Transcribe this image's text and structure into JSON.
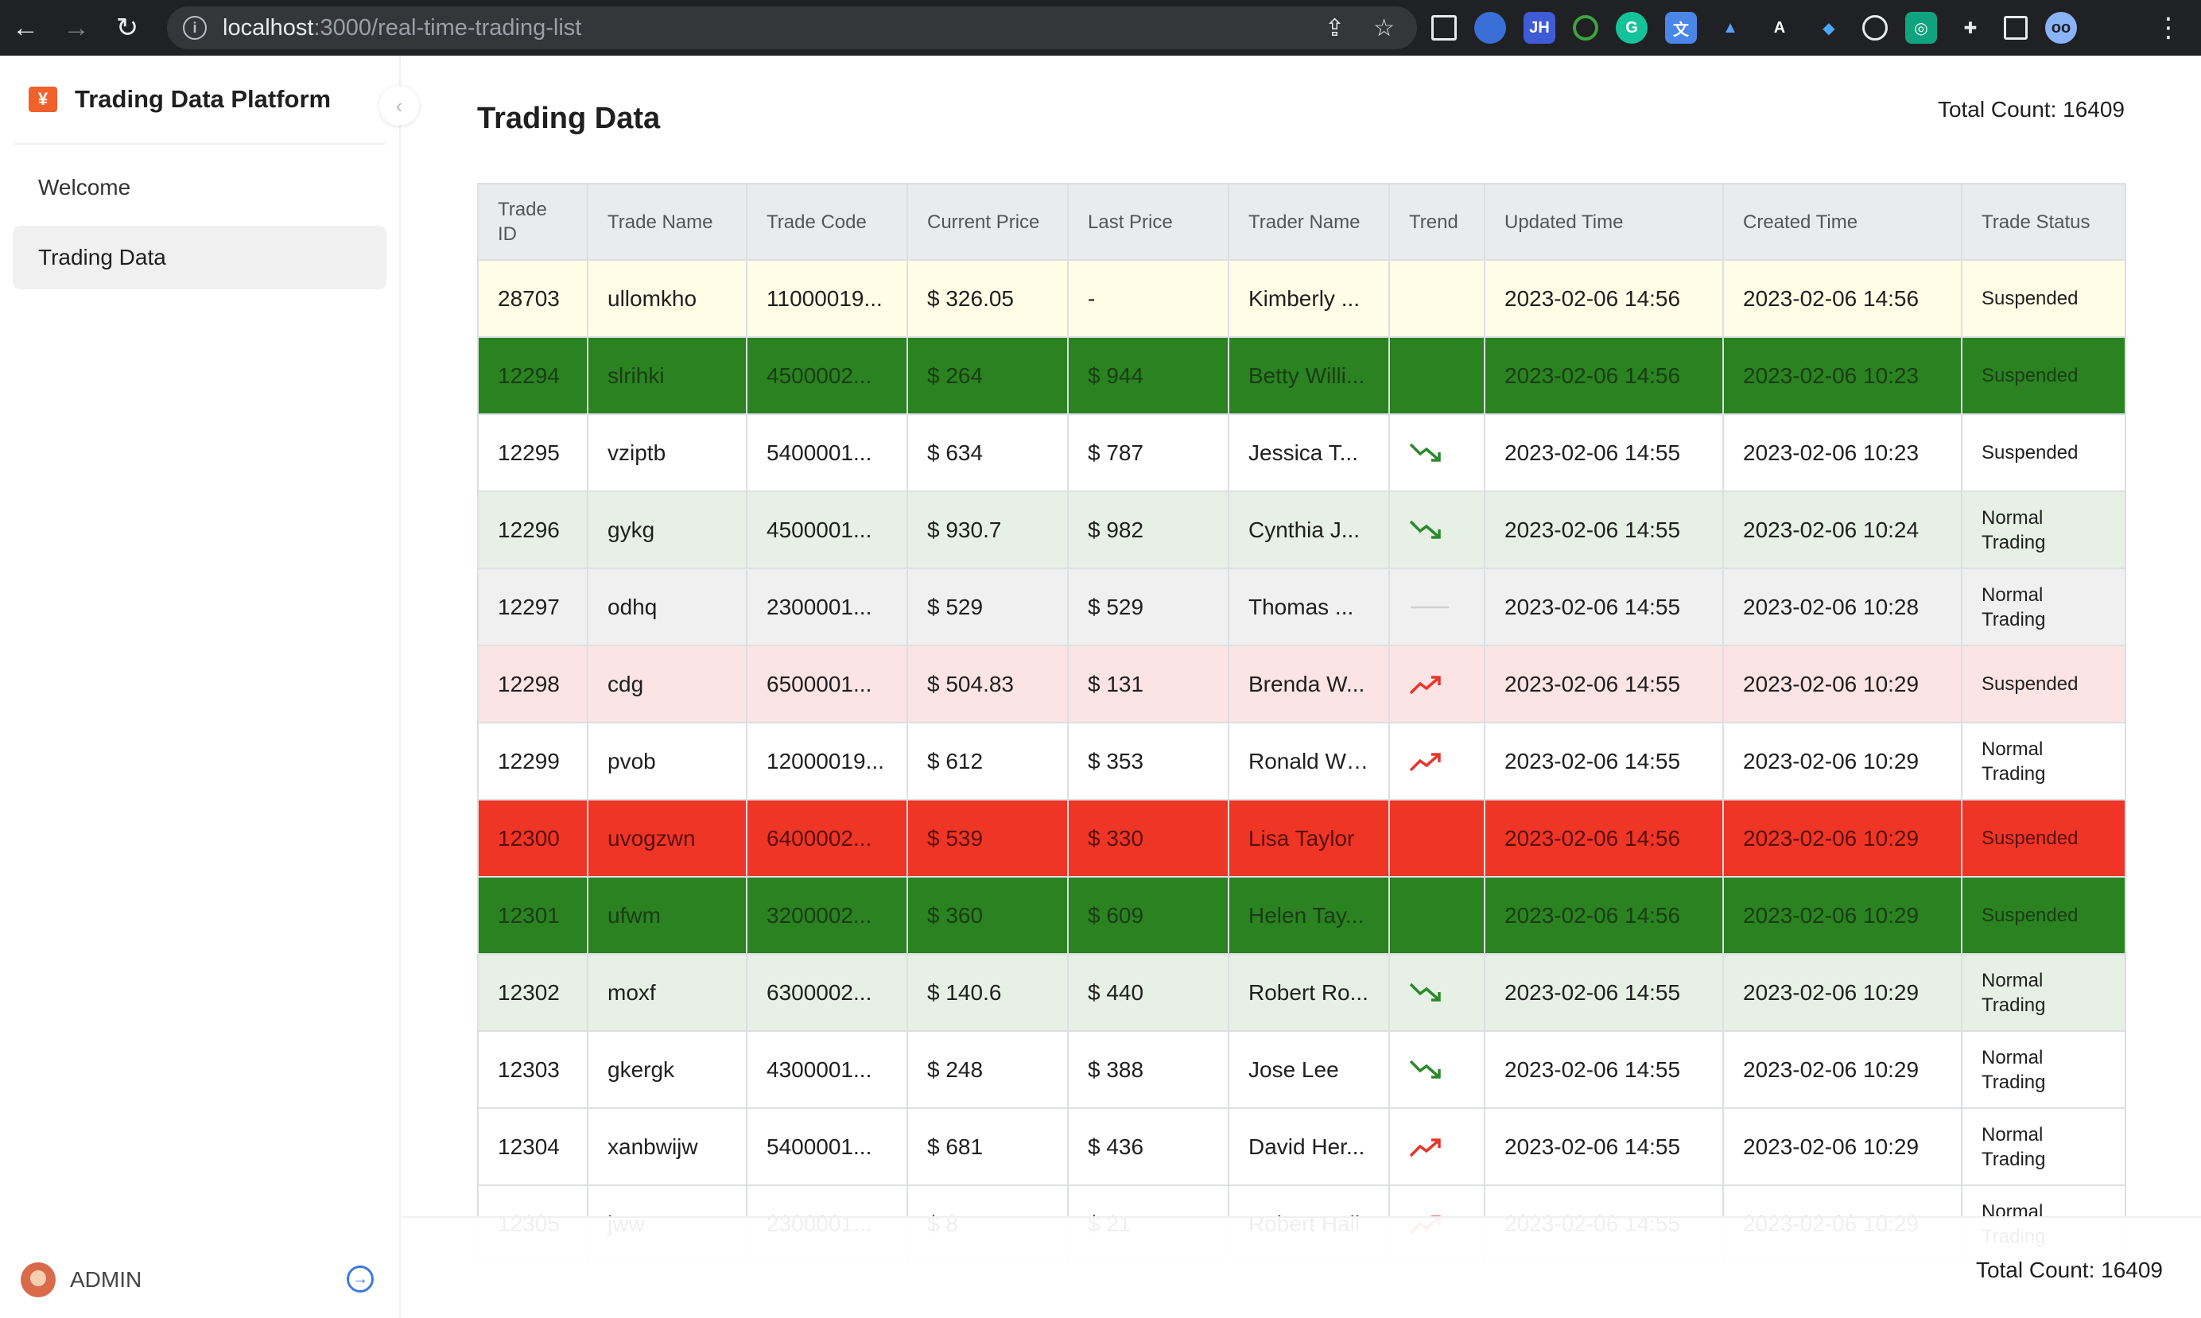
{
  "browser": {
    "url_host": "localhost",
    "url_rest": ":3000/real-time-trading-list"
  },
  "sidebar": {
    "brand_logo": "¥",
    "brand_title": "Trading Data Platform",
    "items": [
      {
        "label": "Welcome",
        "active": false
      },
      {
        "label": "Trading Data",
        "active": true
      }
    ],
    "user": "ADMIN"
  },
  "main": {
    "title": "Trading Data",
    "total_count": "Total Count: 16409",
    "footer_total": "Total Count: 16409"
  },
  "table": {
    "columns": [
      "Trade ID",
      "Trade Name",
      "Trade Code",
      "Current Price",
      "Last Price",
      "Trader Name",
      "Trend",
      "Updated Time",
      "Created Time",
      "Trade Status"
    ],
    "rows": [
      {
        "id": "28703",
        "name": "ullomkho",
        "code": "11000019...",
        "current": "$ 326.05",
        "last": "-",
        "trader": "Kimberly ...",
        "trend": "none",
        "updated": "2023-02-06 14:56",
        "created": "2023-02-06 14:56",
        "status": "Suspended",
        "style": "yellow"
      },
      {
        "id": "12294",
        "name": "slrihki",
        "code": "4500002...",
        "current": "$ 264",
        "last": "$ 944",
        "trader": "Betty Willi...",
        "trend": "none",
        "updated": "2023-02-06 14:56",
        "created": "2023-02-06 10:23",
        "status": "Suspended",
        "style": "green-dark"
      },
      {
        "id": "12295",
        "name": "vziptb",
        "code": "5400001...",
        "current": "$ 634",
        "last": "$ 787",
        "trader": "Jessica T...",
        "trend": "down",
        "updated": "2023-02-06 14:55",
        "created": "2023-02-06 10:23",
        "status": "Suspended",
        "style": "white"
      },
      {
        "id": "12296",
        "name": "gykg",
        "code": "4500001...",
        "current": "$ 930.7",
        "last": "$ 982",
        "trader": "Cynthia J...",
        "trend": "down",
        "updated": "2023-02-06 14:55",
        "created": "2023-02-06 10:24",
        "status": "Normal Trading",
        "style": "green-light"
      },
      {
        "id": "12297",
        "name": "odhq",
        "code": "2300001...",
        "current": "$ 529",
        "last": "$ 529",
        "trader": "Thomas ...",
        "trend": "flat",
        "updated": "2023-02-06 14:55",
        "created": "2023-02-06 10:28",
        "status": "Normal Trading",
        "style": "gray"
      },
      {
        "id": "12298",
        "name": "cdg",
        "code": "6500001...",
        "current": "$ 504.83",
        "last": "$ 131",
        "trader": "Brenda W...",
        "trend": "up",
        "updated": "2023-02-06 14:55",
        "created": "2023-02-06 10:29",
        "status": "Suspended",
        "style": "pink"
      },
      {
        "id": "12299",
        "name": "pvob",
        "code": "12000019...",
        "current": "$ 612",
        "last": "$ 353",
        "trader": "Ronald Wi...",
        "trend": "up",
        "updated": "2023-02-06 14:55",
        "created": "2023-02-06 10:29",
        "status": "Normal Trading",
        "style": "white"
      },
      {
        "id": "12300",
        "name": "uvogzwn",
        "code": "6400002...",
        "current": "$ 539",
        "last": "$ 330",
        "trader": "Lisa Taylor",
        "trend": "none",
        "updated": "2023-02-06 14:56",
        "created": "2023-02-06 10:29",
        "status": "Suspended",
        "style": "red"
      },
      {
        "id": "12301",
        "name": "ufwm",
        "code": "3200002...",
        "current": "$ 360",
        "last": "$ 609",
        "trader": "Helen Tay...",
        "trend": "none",
        "updated": "2023-02-06 14:56",
        "created": "2023-02-06 10:29",
        "status": "Suspended",
        "style": "green-dark"
      },
      {
        "id": "12302",
        "name": "moxf",
        "code": "6300002...",
        "current": "$ 140.6",
        "last": "$ 440",
        "trader": "Robert Ro...",
        "trend": "down",
        "updated": "2023-02-06 14:55",
        "created": "2023-02-06 10:29",
        "status": "Normal Trading",
        "style": "green-light"
      },
      {
        "id": "12303",
        "name": "gkergk",
        "code": "4300001...",
        "current": "$ 248",
        "last": "$ 388",
        "trader": "Jose Lee",
        "trend": "down",
        "updated": "2023-02-06 14:55",
        "created": "2023-02-06 10:29",
        "status": "Normal Trading",
        "style": "white"
      },
      {
        "id": "12304",
        "name": "xanbwijw",
        "code": "5400001...",
        "current": "$ 681",
        "last": "$ 436",
        "trader": "David Her...",
        "trend": "up",
        "updated": "2023-02-06 14:55",
        "created": "2023-02-06 10:29",
        "status": "Normal Trading",
        "style": "white"
      },
      {
        "id": "12305",
        "name": "jww",
        "code": "2300001...",
        "current": "$ 8",
        "last": "$ 21",
        "trader": "Robert Hall",
        "trend": "up",
        "updated": "2023-02-06 14:55",
        "created": "2023-02-06 10:29",
        "status": "Normal Trading",
        "style": "white"
      }
    ]
  },
  "colors": {
    "trend_up": "#e8352a",
    "trend_down": "#2a8a2a",
    "trend_flat": "#d0d0d0",
    "accent": "#3a7be0"
  }
}
